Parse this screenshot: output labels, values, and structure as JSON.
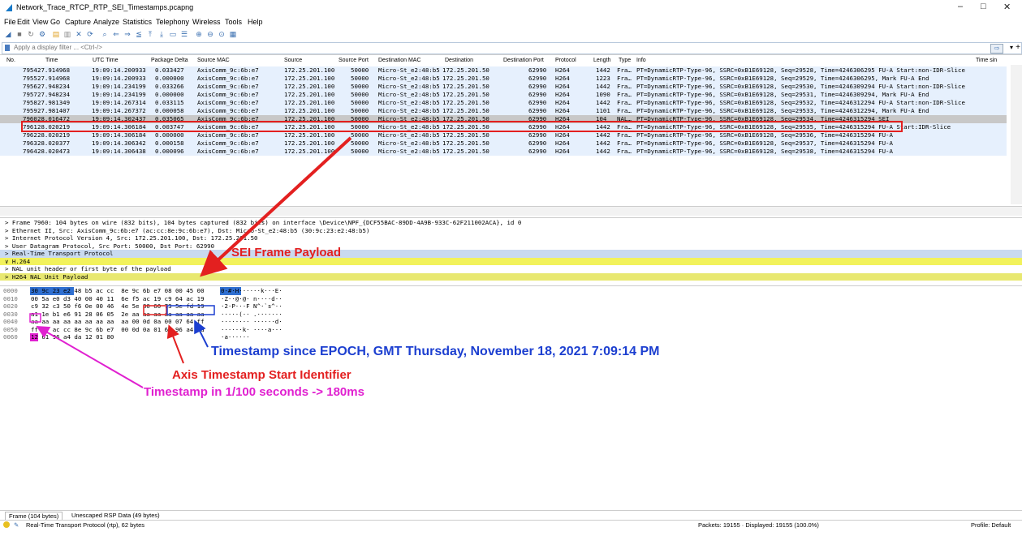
{
  "window": {
    "title": "Network_Trace_RTCP_RTP_SEI_Timestamps.pcapng",
    "minimize": "–",
    "maximize": "□",
    "close": "✕"
  },
  "menu": [
    "File",
    "Edit",
    "View",
    "Go",
    "Capture",
    "Analyze",
    "Statistics",
    "Telephony",
    "Wireless",
    "Tools",
    "Help"
  ],
  "filter": {
    "placeholder": "Apply a display filter ... <Ctrl-/>",
    "plus": "+"
  },
  "columns": {
    "no": "No.",
    "time": "Time",
    "utc": "UTC Time",
    "delta": "Package Delta",
    "srcmac": "Source MAC",
    "source": "Source",
    "srcport": "Source Port",
    "dstmac": "Destination MAC",
    "dest": "Destination",
    "dstport": "Destination Port",
    "proto": "Protocol",
    "length": "Length",
    "type": "Type",
    "info": "Info",
    "timesin": "Time sin"
  },
  "packets": [
    {
      "no": "7954",
      "time": "27.914968",
      "utc": "19:09:14.200933",
      "delta": "0.033427",
      "srcmac": "AxisComm_9c:6b:e7",
      "source": "172.25.201.100",
      "srcport": "50000",
      "dstmac": "Micro-St_e2:48:b5",
      "dest": "172.25.201.50",
      "dstport": "62990",
      "proto": "H264",
      "length": "1442",
      "type": "Fra…",
      "info": "PT=DynamicRTP-Type-96, SSRC=0xB1E69128, Seq=29528, Time=4246306295 FU-A Start:non-IDR-Slice"
    },
    {
      "no": "7955",
      "time": "27.914968",
      "utc": "19:09:14.200933",
      "delta": "0.000000",
      "srcmac": "AxisComm_9c:6b:e7",
      "source": "172.25.201.100",
      "srcport": "50000",
      "dstmac": "Micro-St_e2:48:b5",
      "dest": "172.25.201.50",
      "dstport": "62990",
      "proto": "H264",
      "length": "1223",
      "type": "Fra…",
      "info": "PT=DynamicRTP-Type-96, SSRC=0xB1E69128, Seq=29529, Time=4246306295, Mark FU-A End"
    },
    {
      "no": "7956",
      "time": "27.948234",
      "utc": "19:09:14.234199",
      "delta": "0.033266",
      "srcmac": "AxisComm_9c:6b:e7",
      "source": "172.25.201.100",
      "srcport": "50000",
      "dstmac": "Micro-St_e2:48:b5",
      "dest": "172.25.201.50",
      "dstport": "62990",
      "proto": "H264",
      "length": "1442",
      "type": "Fra…",
      "info": "PT=DynamicRTP-Type-96, SSRC=0xB1E69128, Seq=29530, Time=4246309294 FU-A Start:non-IDR-Slice"
    },
    {
      "no": "7957",
      "time": "27.948234",
      "utc": "19:09:14.234199",
      "delta": "0.000000",
      "srcmac": "AxisComm_9c:6b:e7",
      "source": "172.25.201.100",
      "srcport": "50000",
      "dstmac": "Micro-St_e2:48:b5",
      "dest": "172.25.201.50",
      "dstport": "62990",
      "proto": "H264",
      "length": "1090",
      "type": "Fra…",
      "info": "PT=DynamicRTP-Type-96, SSRC=0xB1E69128, Seq=29531, Time=4246309294, Mark FU-A End"
    },
    {
      "no": "7958",
      "time": "27.981349",
      "utc": "19:09:14.267314",
      "delta": "0.033115",
      "srcmac": "AxisComm_9c:6b:e7",
      "source": "172.25.201.100",
      "srcport": "50000",
      "dstmac": "Micro-St_e2:48:b5",
      "dest": "172.25.201.50",
      "dstport": "62990",
      "proto": "H264",
      "length": "1442",
      "type": "Fra…",
      "info": "PT=DynamicRTP-Type-96, SSRC=0xB1E69128, Seq=29532, Time=4246312294 FU-A Start:non-IDR-Slice"
    },
    {
      "no": "7959",
      "time": "27.981407",
      "utc": "19:09:14.267372",
      "delta": "0.000058",
      "srcmac": "AxisComm_9c:6b:e7",
      "source": "172.25.201.100",
      "srcport": "50000",
      "dstmac": "Micro-St_e2:48:b5",
      "dest": "172.25.201.50",
      "dstport": "62990",
      "proto": "H264",
      "length": "1101",
      "type": "Fra…",
      "info": "PT=DynamicRTP-Type-96, SSRC=0xB1E69128, Seq=29533, Time=4246312294, Mark FU-A End"
    },
    {
      "no": "7960",
      "time": "28.016472",
      "utc": "19:09:14.302437",
      "delta": "0.035065",
      "srcmac": "AxisComm_9c:6b:e7",
      "source": "172.25.201.100",
      "srcport": "50000",
      "dstmac": "Micro-St_e2:48:b5",
      "dest": "172.25.201.50",
      "dstport": "62990",
      "proto": "H264",
      "length": "104",
      "type": "NAL…",
      "info": "PT=DynamicRTP-Type-96, SSRC=0xB1E69128, Seq=29534, Time=4246315294 SEI"
    },
    {
      "no": "7961",
      "time": "28.020219",
      "utc": "19:09:14.306184",
      "delta": "0.003747",
      "srcmac": "AxisComm_9c:6b:e7",
      "source": "172.25.201.100",
      "srcport": "50000",
      "dstmac": "Micro-St_e2:48:b5",
      "dest": "172.25.201.50",
      "dstport": "62990",
      "proto": "H264",
      "length": "1442",
      "type": "Fra…",
      "info": "PT=DynamicRTP-Type-96, SSRC=0xB1E69128, Seq=29535, Time=4246315294 FU-A Start:IDR-Slice"
    },
    {
      "no": "7962",
      "time": "28.020219",
      "utc": "19:09:14.306184",
      "delta": "0.000000",
      "srcmac": "AxisComm_9c:6b:e7",
      "source": "172.25.201.100",
      "srcport": "50000",
      "dstmac": "Micro-St_e2:48:b5",
      "dest": "172.25.201.50",
      "dstport": "62990",
      "proto": "H264",
      "length": "1442",
      "type": "Fra…",
      "info": "PT=DynamicRTP-Type-96, SSRC=0xB1E69128, Seq=29536, Time=4246315294 FU-A"
    },
    {
      "no": "7963",
      "time": "28.020377",
      "utc": "19:09:14.306342",
      "delta": "0.000158",
      "srcmac": "AxisComm_9c:6b:e7",
      "source": "172.25.201.100",
      "srcport": "50000",
      "dstmac": "Micro-St_e2:48:b5",
      "dest": "172.25.201.50",
      "dstport": "62990",
      "proto": "H264",
      "length": "1442",
      "type": "Fra…",
      "info": "PT=DynamicRTP-Type-96, SSRC=0xB1E69128, Seq=29537, Time=4246315294 FU-A"
    },
    {
      "no": "7964",
      "time": "28.020473",
      "utc": "19:09:14.306438",
      "delta": "0.000096",
      "srcmac": "AxisComm_9c:6b:e7",
      "source": "172.25.201.100",
      "srcport": "50000",
      "dstmac": "Micro-St_e2:48:b5",
      "dest": "172.25.201.50",
      "dstport": "62990",
      "proto": "H264",
      "length": "1442",
      "type": "Fra…",
      "info": "PT=DynamicRTP-Type-96, SSRC=0xB1E69128, Seq=29538, Time=4246315294 FU-A"
    }
  ],
  "details": [
    {
      "text": "> Frame 7960: 104 bytes on wire (832 bits), 104 bytes captured (832 bits) on interface \\Device\\NPF_{DCF55BAC-89DD-4A9B-933C-62F211002ACA}, id 0",
      "bg": "#ffffff"
    },
    {
      "text": "> Ethernet II, Src: AxisComm_9c:6b:e7 (ac:cc:8e:9c:6b:e7), Dst: Micro-St_e2:48:b5 (30:9c:23:e2:48:b5)",
      "bg": "#ffffff"
    },
    {
      "text": "> Internet Protocol Version 4, Src: 172.25.201.100, Dst: 172.25.201.50",
      "bg": "#ffffff"
    },
    {
      "text": "> User Datagram Protocol, Src Port: 50000, Dst Port: 62990",
      "bg": "#ffffff"
    },
    {
      "text": "> Real-Time Transport Protocol",
      "bg": "#c9daf0"
    },
    {
      "text": "∨ H.264",
      "bg": "#f2f25c"
    },
    {
      "text": "    > NAL unit header or first byte of the payload",
      "bg": "#ffffff"
    },
    {
      "text": "    > H264 NAL Unit Payload",
      "bg": "#e8e870"
    }
  ],
  "bytes": [
    {
      "off": "0000",
      "hex": "30 9c 23 e2 48 b5 ac cc  8e 9c 6b e7 08 00 45 00",
      "ascii": "0·#·H······k···E·"
    },
    {
      "off": "0010",
      "hex": "00 5a e0 d3 40 00 40 11  6e f5 ac 19 c9 64 ac 19",
      "ascii": "·Z··@·@· n····d··"
    },
    {
      "off": "0020",
      "hex": "c9 32 c3 50 f6 0e 00 46  4e 5e 80 60 73 5e fd 19",
      "ascii": "·2·P···F N^·`s^··"
    },
    {
      "off": "0030",
      "hex": "a1 1e b1 e6 91 28 06 05  2e aa aa aa aa aa aa aa",
      "ascii": "·····(·· .·······"
    },
    {
      "off": "0040",
      "hex": "aa aa aa aa aa aa aa aa  aa 00 0d 0a 00 07 64 ff",
      "ascii": "········ ······d·"
    },
    {
      "off": "0050",
      "hex": "ff ff ac cc 8e 9c 6b e7  00 0d 0a 01 61 96 a4 da",
      "ascii": "······k· ····a···"
    },
    {
      "off": "0060",
      "hex": "12 61 96 a4 da 12 01 80",
      "ascii": "·a······"
    }
  ],
  "annotations": {
    "sei": "SEI Frame Payload",
    "epoch": "Timestamp since EPOCH, GMT Thursday, November 18, 2021 7:09:14 PM",
    "axis": "Axis Timestamp Start Identifier",
    "hundredths": "Timestamp in 1/100 seconds -> 180ms"
  },
  "bottom_tabs": [
    "Frame (104 bytes)",
    "Unescaped RSP Data (49 bytes)"
  ],
  "status": {
    "left": "Real-Time Transport Protocol (rtp), 62 bytes",
    "packets": "Packets: 19155 · Displayed: 19155 (100.0%)",
    "profile": "Profile: Default"
  },
  "colors": {
    "selected_row": "#c8c8c8",
    "row_bg": "#e6f0fd",
    "annot_red": "#e32020",
    "annot_blue": "#1c3fd0",
    "annot_magenta": "#e020d0"
  }
}
